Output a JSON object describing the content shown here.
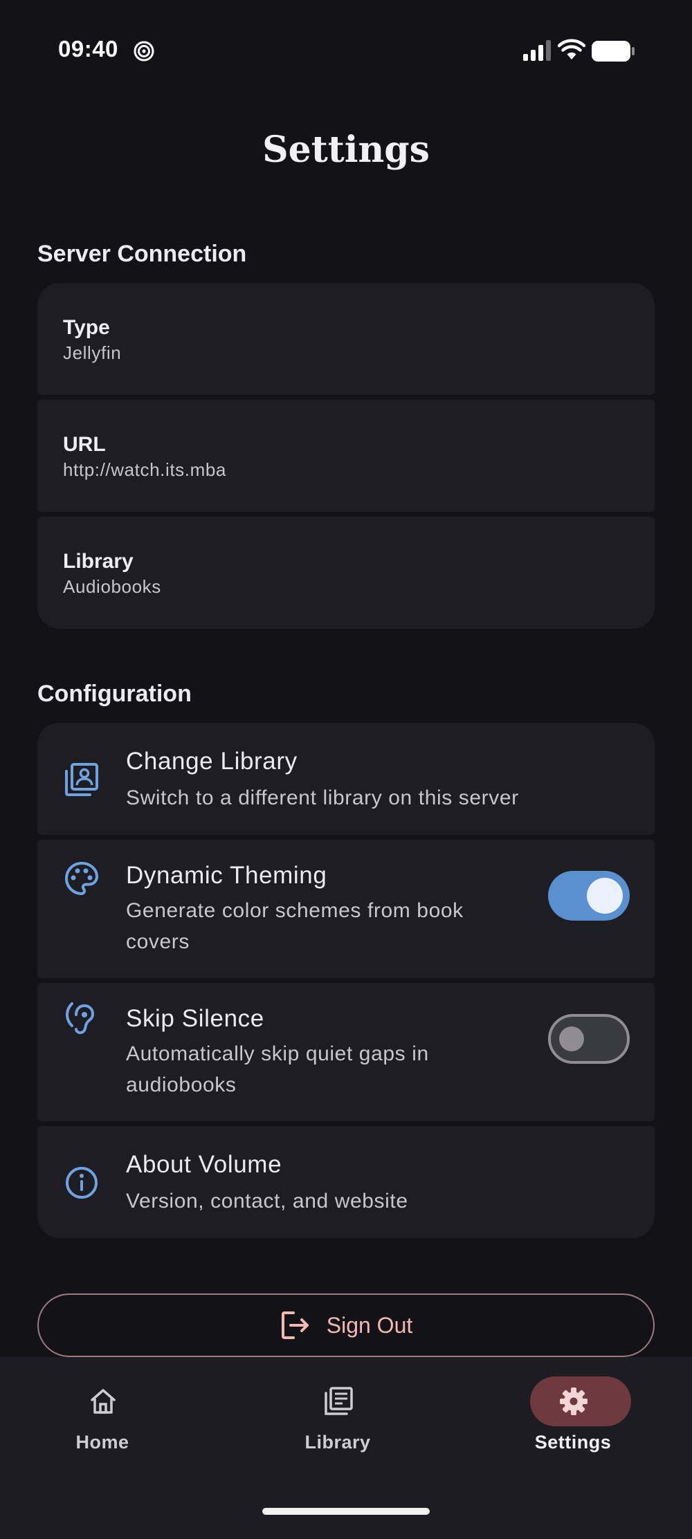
{
  "status_bar": {
    "time": "09:40"
  },
  "page": {
    "title": "Settings"
  },
  "server_connection": {
    "section_title": "Server Connection",
    "items": [
      {
        "label": "Type",
        "value": "Jellyfin"
      },
      {
        "label": "URL",
        "value": "http://watch.its.mba"
      },
      {
        "label": "Library",
        "value": "Audiobooks"
      }
    ]
  },
  "configuration": {
    "section_title": "Configuration",
    "items": [
      {
        "title": "Change Library",
        "description": "Switch to a different library on this server",
        "icon": "library-icon"
      },
      {
        "title": "Dynamic Theming",
        "description": "Generate color schemes from book covers",
        "icon": "palette-icon",
        "toggle": true
      },
      {
        "title": "Skip Silence",
        "description": "Automatically skip quiet gaps in audiobooks",
        "icon": "hearing-icon",
        "toggle": false
      },
      {
        "title": "About Volume",
        "description": "Version, contact, and website",
        "icon": "info-icon"
      }
    ]
  },
  "sign_out": {
    "label": "Sign Out"
  },
  "bottom_nav": {
    "items": [
      {
        "label": "Home",
        "icon": "home-icon",
        "active": false
      },
      {
        "label": "Library",
        "icon": "library-nav-icon",
        "active": false
      },
      {
        "label": "Settings",
        "icon": "gear-icon",
        "active": true
      }
    ]
  },
  "colors": {
    "background": "#121217",
    "card": "#1D1D23",
    "accent_blue": "#5A8FD0",
    "sign_out_text": "#F3B9B5",
    "nav_active_pill": "#6E3A3D"
  }
}
